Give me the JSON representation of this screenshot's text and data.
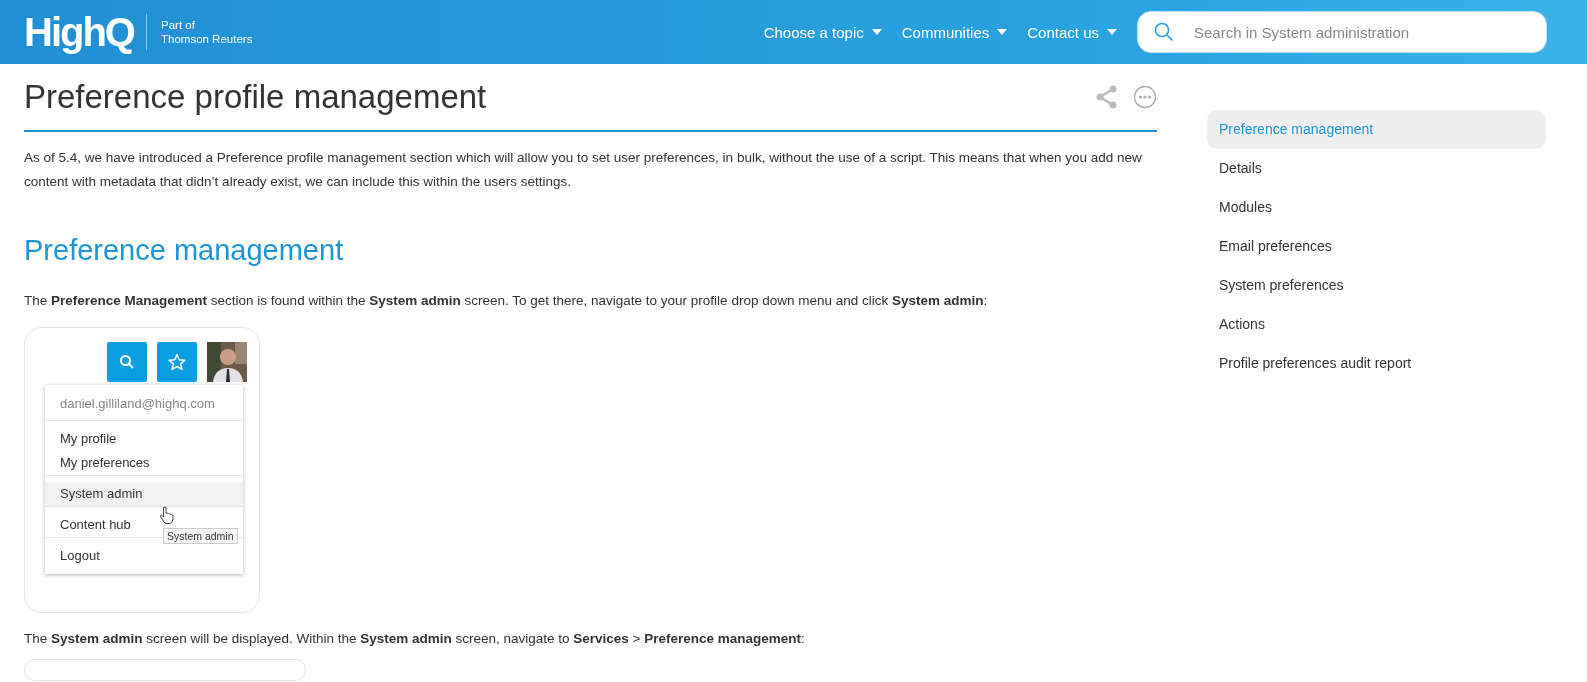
{
  "header": {
    "logo": "HighQ",
    "tagline": [
      "Part of",
      "Thomson Reuters"
    ],
    "nav": [
      {
        "label": "Choose a topic"
      },
      {
        "label": "Communities"
      },
      {
        "label": "Contact us"
      }
    ],
    "search": {
      "placeholder": "Search in System administration"
    }
  },
  "article": {
    "title": "Preference profile management",
    "intro": "As of 5.4, we have introduced a Preference profile management section which will allow you to set user preferences, in bulk, without the use of a script. This means that when you add new content with metadata that didn’t already exist, we can include this within the users settings.",
    "section": {
      "heading": "Preference management",
      "before": "The **Preference Management** section is found within the **System admin** screen. To get there, navigate to your profile drop down menu and click **System admin**:",
      "screenshot": {
        "email": "daniel.gilliland@highq.com",
        "menu": [
          {
            "label": "My profile",
            "divider_above": true,
            "selected": false
          },
          {
            "label": "My preferences",
            "divider_above": false,
            "selected": false
          },
          {
            "label": "System admin",
            "divider_above": true,
            "selected": true
          },
          {
            "label": "Content hub",
            "divider_above": true,
            "selected": false
          },
          {
            "label": "Logout",
            "divider_above": true,
            "selected": false
          }
        ],
        "tooltip": "System admin"
      },
      "after": "The **System admin** screen will be displayed. Within the **System admin** screen, navigate to **Services** > **Preference management**:"
    }
  },
  "toc": [
    {
      "label": "Preference management",
      "selected": true
    },
    {
      "label": "Details",
      "selected": false
    },
    {
      "label": "Modules",
      "selected": false
    },
    {
      "label": "Email preferences",
      "selected": false
    },
    {
      "label": "System preferences",
      "selected": false
    },
    {
      "label": "Actions",
      "selected": false
    },
    {
      "label": "Profile preferences audit report",
      "selected": false
    }
  ]
}
